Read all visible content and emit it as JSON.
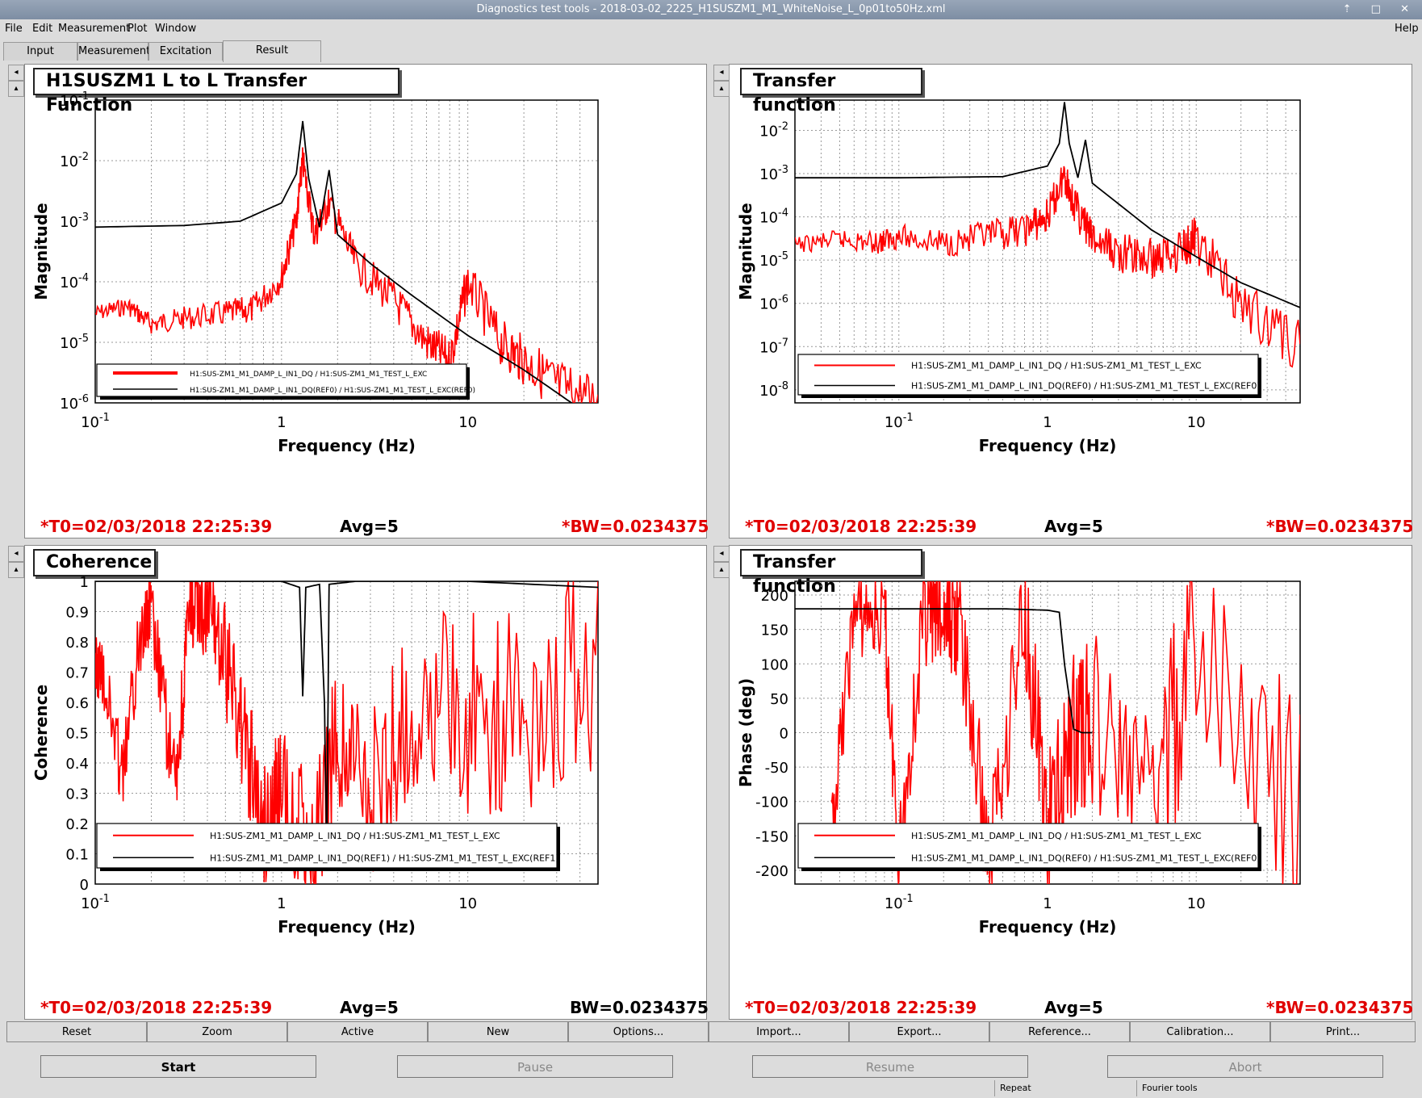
{
  "window": {
    "title": "Diagnostics test tools - 2018-03-02_2225_H1SUSZM1_M1_WhiteNoise_L_0p01to50Hz.xml",
    "controls": "⇡ □ ✕"
  },
  "menu": {
    "file": "File",
    "edit": "Edit",
    "measurement": "Measurement",
    "plot": "Plot",
    "window": "Window",
    "help": "Help"
  },
  "tabs": [
    "Input",
    "Measurement",
    "Excitation",
    "Result"
  ],
  "panes": [
    {
      "title": "H1SUSZM1 L to L Transfer Function",
      "ylabel": "Magnitude",
      "xlabel": "Frequency (Hz)",
      "yticks": [
        "10^-1",
        "10^-2",
        "10^-3",
        "10^-4",
        "10^-5",
        "10^-6"
      ],
      "xticks": [
        "10^-1",
        "1",
        "10"
      ],
      "legend": [
        "H1:SUS-ZM1_M1_DAMP_L_IN1_DQ / H1:SUS-ZM1_M1_TEST_L_EXC",
        "H1:SUS-ZM1_M1_DAMP_L_IN1_DQ(REF0) / H1:SUS-ZM1_M1_TEST_L_EXC(REF0)"
      ],
      "t0": "*T0=02/03/2018 22:25:39",
      "avg": "Avg=5",
      "bw": "*BW=0.0234375"
    },
    {
      "title": "Transfer function",
      "ylabel": "Magnitude",
      "xlabel": "Frequency (Hz)",
      "yticks": [
        "10^-2",
        "10^-3",
        "10^-4",
        "10^-5",
        "10^-6",
        "10^-7",
        "10^-8"
      ],
      "xticks": [
        "10^-1",
        "1",
        "10"
      ],
      "legend": [
        "H1:SUS-ZM1_M1_DAMP_L_IN1_DQ / H1:SUS-ZM1_M1_TEST_L_EXC",
        "H1:SUS-ZM1_M1_DAMP_L_IN1_DQ(REF0) / H1:SUS-ZM1_M1_TEST_L_EXC(REF0)"
      ],
      "t0": "*T0=02/03/2018 22:25:39",
      "avg": "Avg=5",
      "bw": "*BW=0.0234375"
    },
    {
      "title": "Coherence",
      "ylabel": "Coherence",
      "xlabel": "Frequency (Hz)",
      "yticks": [
        "1",
        "0.9",
        "0.8",
        "0.7",
        "0.6",
        "0.5",
        "0.4",
        "0.3",
        "0.2",
        "0.1",
        "0"
      ],
      "xticks": [
        "10^-1",
        "1",
        "10"
      ],
      "legend": [
        "H1:SUS-ZM1_M1_DAMP_L_IN1_DQ / H1:SUS-ZM1_M1_TEST_L_EXC",
        "H1:SUS-ZM1_M1_DAMP_L_IN1_DQ(REF1) / H1:SUS-ZM1_M1_TEST_L_EXC(REF1)"
      ],
      "t0": "*T0=02/03/2018 22:25:39",
      "avg": "Avg=5",
      "bw": "BW=0.0234375"
    },
    {
      "title": "Transfer function",
      "ylabel": "Phase (deg)",
      "xlabel": "Frequency (Hz)",
      "yticks": [
        "200",
        "150",
        "100",
        "50",
        "0",
        "-50",
        "-100",
        "-150",
        "-200"
      ],
      "xticks": [
        "10^-1",
        "1",
        "10"
      ],
      "legend": [
        "H1:SUS-ZM1_M1_DAMP_L_IN1_DQ / H1:SUS-ZM1_M1_TEST_L_EXC",
        "H1:SUS-ZM1_M1_DAMP_L_IN1_DQ(REF0) / H1:SUS-ZM1_M1_TEST_L_EXC(REF0)"
      ],
      "t0": "*T0=02/03/2018 22:25:39",
      "avg": "Avg=5",
      "bw": "*BW=0.0234375"
    }
  ],
  "chart_data": [
    {
      "type": "line",
      "title": "H1SUSZM1 L to L Transfer Function",
      "xlabel": "Frequency (Hz)",
      "ylabel": "Magnitude",
      "xscale": "log",
      "yscale": "log",
      "xlim": [
        0.1,
        50
      ],
      "ylim": [
        1e-06,
        0.1
      ],
      "legend_position": "bottom-left",
      "series": [
        {
          "name": "H1:SUS-ZM1_M1_DAMP_L_IN1_DQ / H1:SUS-ZM1_M1_TEST_L_EXC",
          "color": "#ff0000",
          "x": [
            0.1,
            0.15,
            0.2,
            0.3,
            0.5,
            0.7,
            1.0,
            1.2,
            1.3,
            1.5,
            1.8,
            2.5,
            4,
            6,
            8,
            10,
            15,
            20,
            30,
            50
          ],
          "y": [
            3e-05,
            4e-05,
            2e-05,
            2.5e-05,
            3e-05,
            3.5e-05,
            0.00012,
            0.001,
            0.01,
            0.0006,
            0.002,
            0.0002,
            5e-05,
            1e-05,
            5e-06,
            0.0001,
            1e-05,
            5e-06,
            2e-06,
            1e-06
          ]
        },
        {
          "name": "H1:SUS-ZM1_M1_DAMP_L_IN1_DQ(REF0) / H1:SUS-ZM1_M1_TEST_L_EXC(REF0)",
          "color": "#000000",
          "x": [
            0.1,
            0.3,
            0.6,
            1.0,
            1.2,
            1.3,
            1.4,
            1.6,
            1.8,
            2.0,
            3,
            5,
            10,
            20,
            50
          ],
          "y": [
            0.0008,
            0.00085,
            0.001,
            0.002,
            0.006,
            0.045,
            0.005,
            0.0008,
            0.007,
            0.0006,
            0.0002,
            6e-05,
            1.3e-05,
            3.5e-06,
            5e-07
          ]
        }
      ]
    },
    {
      "type": "line",
      "title": "Transfer function",
      "xlabel": "Frequency (Hz)",
      "ylabel": "Magnitude",
      "xscale": "log",
      "yscale": "log",
      "xlim": [
        0.02,
        50
      ],
      "ylim": [
        5e-09,
        0.05
      ],
      "legend_position": "bottom-left",
      "series": [
        {
          "name": "H1:SUS-ZM1_M1_DAMP_L_IN1_DQ / H1:SUS-ZM1_M1_TEST_L_EXC",
          "color": "#ff0000",
          "x": [
            0.02,
            0.04,
            0.07,
            0.1,
            0.2,
            0.4,
            0.7,
            1.0,
            1.3,
            1.5,
            2,
            3,
            5,
            8,
            10,
            20,
            50
          ],
          "y": [
            2.2e-05,
            3e-05,
            2.5e-05,
            3.5e-05,
            2.5e-05,
            3.5e-05,
            5e-05,
            0.0001,
            0.001,
            0.0002,
            3e-05,
            1.5e-05,
            1e-05,
            2e-05,
            3e-05,
            1e-06,
            1e-07
          ]
        },
        {
          "name": "H1:SUS-ZM1_M1_DAMP_L_IN1_DQ(REF0) / H1:SUS-ZM1_M1_TEST_L_EXC(REF0)",
          "color": "#000000",
          "x": [
            0.02,
            0.1,
            0.5,
            1.0,
            1.2,
            1.3,
            1.4,
            1.6,
            1.8,
            2.0,
            3,
            5,
            10,
            20,
            50
          ],
          "y": [
            0.0008,
            0.0008,
            0.00085,
            0.0015,
            0.005,
            0.045,
            0.005,
            0.0008,
            0.006,
            0.0006,
            0.0002,
            5e-05,
            1.2e-05,
            3e-06,
            8e-07
          ]
        }
      ]
    },
    {
      "type": "line",
      "title": "Coherence",
      "xlabel": "Frequency (Hz)",
      "ylabel": "Coherence",
      "xscale": "log",
      "yscale": "linear",
      "xlim": [
        0.1,
        50
      ],
      "ylim": [
        0,
        1
      ],
      "legend_position": "bottom-left",
      "series": [
        {
          "name": "H1:SUS-ZM1_M1_DAMP_L_IN1_DQ / H1:SUS-ZM1_M1_TEST_L_EXC",
          "color": "#ff0000",
          "x": [
            0.1,
            0.11,
            0.14,
            0.18,
            0.2,
            0.27,
            0.32,
            0.37,
            0.45,
            0.6,
            0.8,
            1.0,
            1.5,
            2,
            3,
            5,
            10,
            20,
            50
          ],
          "y": [
            0.72,
            0.7,
            0.35,
            0.88,
            0.89,
            0.3,
            0.9,
            0.93,
            0.85,
            0.55,
            0.2,
            0.3,
            0.1,
            0.5,
            0.3,
            0.6,
            0.55,
            0.6,
            0.8
          ]
        },
        {
          "name": "H1:SUS-ZM1_M1_DAMP_L_IN1_DQ(REF1) / H1:SUS-ZM1_M1_TEST_L_EXC(REF1)",
          "color": "#000000",
          "x": [
            0.1,
            1.0,
            1.25,
            1.3,
            1.35,
            1.6,
            1.7,
            1.75,
            1.8,
            2.5,
            10,
            50
          ],
          "y": [
            1,
            1,
            0.98,
            0.62,
            0.98,
            0.99,
            0.6,
            0.1,
            0.99,
            1,
            1,
            0.98
          ]
        }
      ]
    },
    {
      "type": "line",
      "title": "Transfer function",
      "xlabel": "Frequency (Hz)",
      "ylabel": "Phase (deg)",
      "xscale": "log",
      "yscale": "linear",
      "xlim": [
        0.02,
        50
      ],
      "ylim": [
        -220,
        220
      ],
      "legend_position": "bottom-left",
      "series": [
        {
          "name": "H1:SUS-ZM1_M1_DAMP_L_IN1_DQ / H1:SUS-ZM1_M1_TEST_L_EXC",
          "color": "#ff0000",
          "x": [
            0.035,
            0.05,
            0.08,
            0.1,
            0.15,
            0.2,
            0.25,
            0.4,
            0.7,
            1.0,
            1.5,
            2,
            5,
            10,
            50
          ],
          "y": [
            -150,
            175,
            170,
            -180,
            180,
            160,
            170,
            -180,
            180,
            -150,
            0,
            20,
            -100,
            120,
            -150
          ]
        },
        {
          "name": "H1:SUS-ZM1_M1_DAMP_L_IN1_DQ(REF0) / H1:SUS-ZM1_M1_TEST_L_EXC(REF0)",
          "color": "#000000",
          "x": [
            0.02,
            0.5,
            1.0,
            1.2,
            1.3,
            1.5,
            1.7,
            2.0
          ],
          "y": [
            180,
            180,
            178,
            175,
            100,
            5,
            0,
            0
          ]
        }
      ]
    }
  ],
  "buttons": [
    "Reset",
    "Zoom",
    "Active",
    "New",
    "Options...",
    "Import...",
    "Export...",
    "Reference...",
    "Calibration...",
    "Print..."
  ],
  "actions": {
    "start": "Start",
    "pause": "Pause",
    "resume": "Resume",
    "abort": "Abort"
  },
  "status": {
    "repeat": "Repeat",
    "fourier": "Fourier tools"
  },
  "colors": {
    "red": "#ff0000",
    "black": "#000000",
    "background": "#dcdcdc"
  }
}
